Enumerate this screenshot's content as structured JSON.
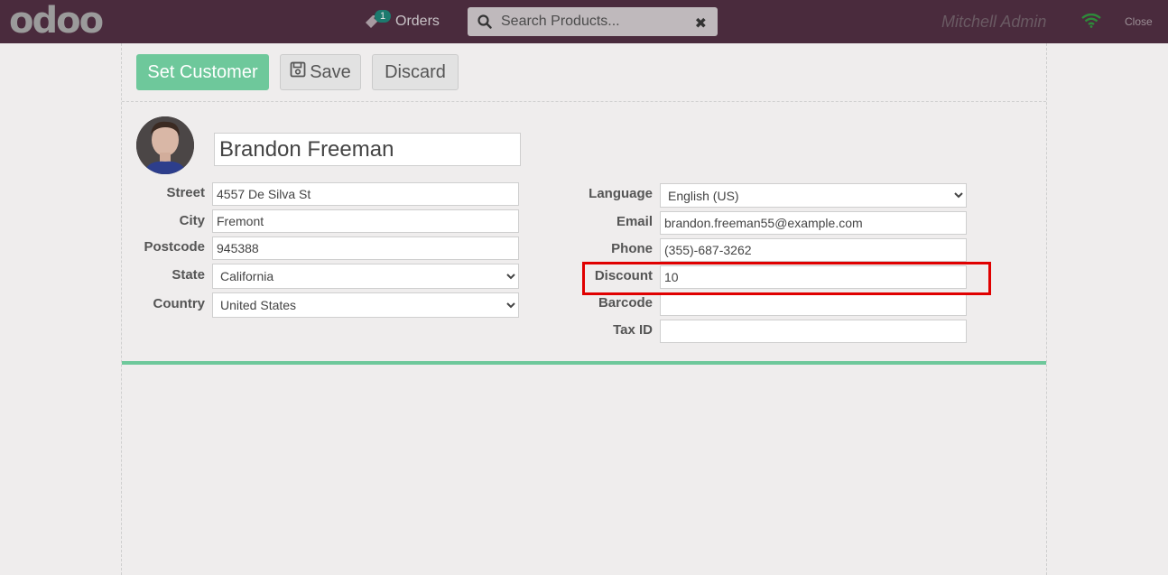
{
  "navbar": {
    "logo": "odoo",
    "orders_label": "Orders",
    "orders_count": "1",
    "search_placeholder": "Search Products...",
    "user_name": "Mitchell Admin",
    "close_label": "Close"
  },
  "toolbar": {
    "set_customer_label": "Set Customer",
    "save_label": "Save",
    "discard_label": "Discard"
  },
  "customer": {
    "name": "Brandon Freeman",
    "street_label": "Street",
    "street": "4557 De Silva St",
    "city_label": "City",
    "city": "Fremont",
    "postcode_label": "Postcode",
    "postcode": "945388",
    "state_label": "State",
    "state": "California",
    "country_label": "Country",
    "country": "United States",
    "language_label": "Language",
    "language": "English (US)",
    "email_label": "Email",
    "email": "brandon.freeman55@example.com",
    "phone_label": "Phone",
    "phone": "(355)-687-3262",
    "discount_label": "Discount",
    "discount": "10",
    "barcode_label": "Barcode",
    "barcode": "",
    "taxid_label": "Tax ID",
    "taxid": ""
  },
  "colors": {
    "navbar": "#4a2b3d",
    "primary": "#6ec89b",
    "highlight": "#e00000"
  }
}
